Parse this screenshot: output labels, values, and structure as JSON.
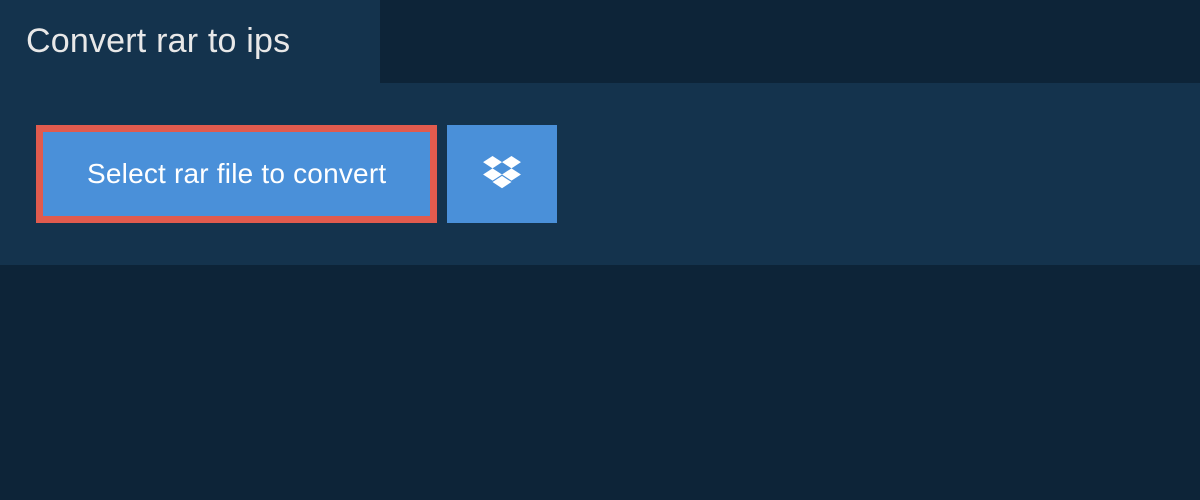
{
  "tab": {
    "title": "Convert rar to ips"
  },
  "actions": {
    "select_file_label": "Select rar file to convert"
  },
  "colors": {
    "background_dark": "#0d2438",
    "panel": "#14334d",
    "button_primary": "#4a90d9",
    "highlight_border": "#e15b4e",
    "text_light": "#e8e8e8",
    "text_white": "#ffffff"
  },
  "icons": {
    "dropbox": "dropbox-icon"
  }
}
